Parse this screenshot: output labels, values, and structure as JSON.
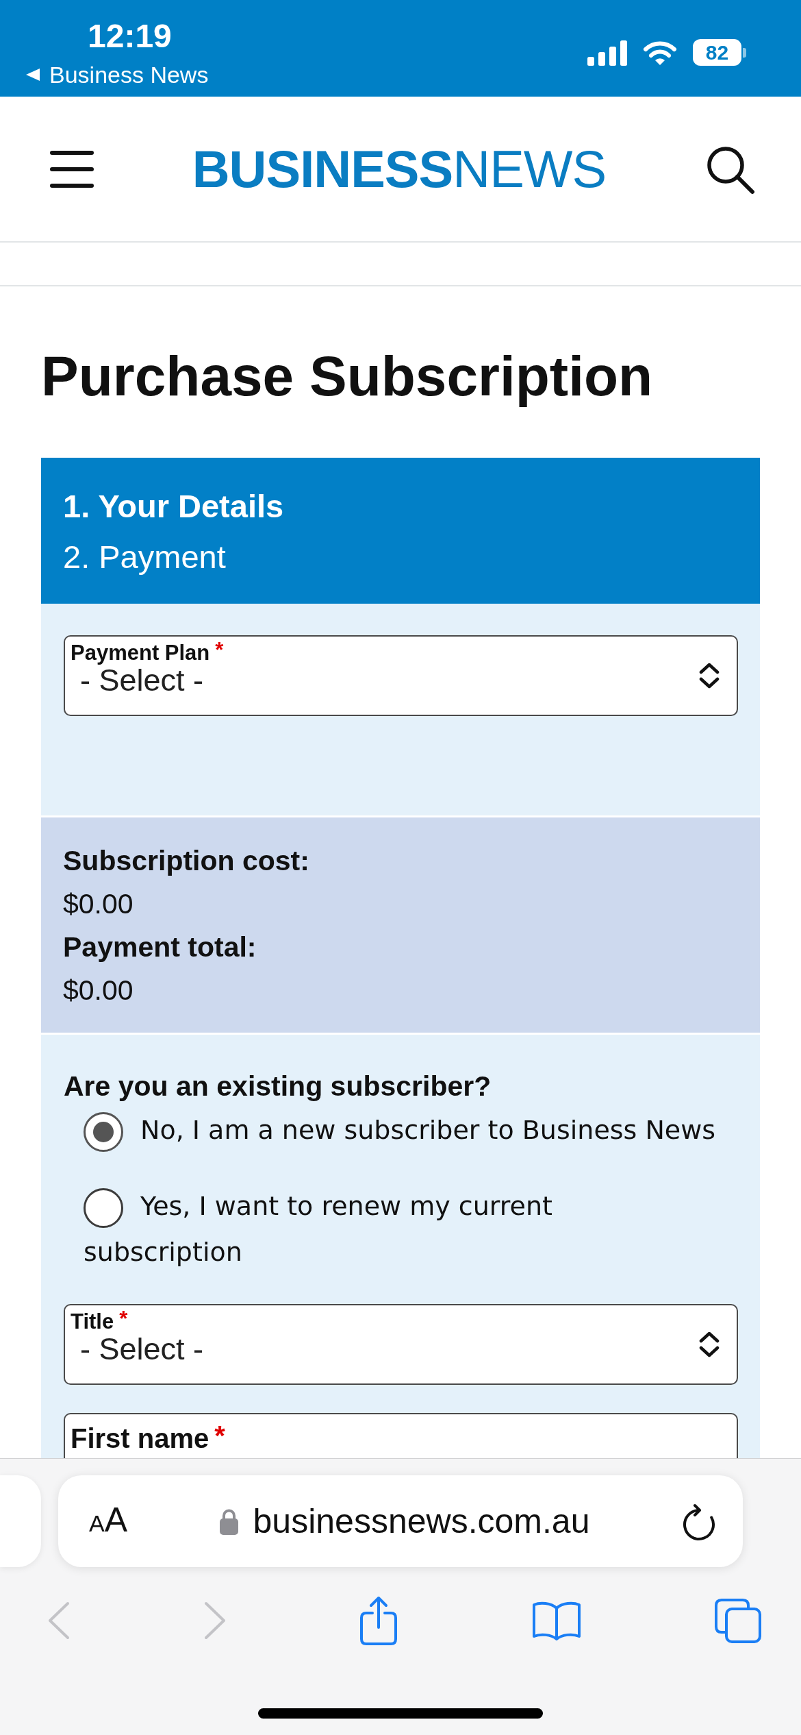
{
  "status_bar": {
    "time": "12:19",
    "back_label": "Business News",
    "battery": "82"
  },
  "header": {
    "logo": "**BUSINESS**NEWS"
  },
  "page_title": "Purchase Subscription",
  "steps": [
    {
      "label": "1. Your Details",
      "selected": true
    },
    {
      "label": "2. Payment",
      "selected": false
    }
  ],
  "plan_field": {
    "kind": "select",
    "label": "Payment Plan",
    "required_mark": "*",
    "value": "- Select -"
  },
  "summary": [
    {
      "label": "Subscription cost:",
      "value": "$0.00"
    },
    {
      "label": "Payment total:",
      "value": "$0.00"
    }
  ],
  "subscriber_question": {
    "label": "Are you an existing subscriber?",
    "options": [
      {
        "label": "No, I am a new subscriber to Business News",
        "selected": true
      },
      {
        "label": "Yes, I want to renew my current subscription",
        "selected": false
      }
    ]
  },
  "detail_fields": [
    {
      "kind": "select",
      "label": "Title",
      "required_mark": "*",
      "value": "- Select -"
    },
    {
      "kind": "text",
      "label": "First name",
      "required_mark": "*"
    }
  ],
  "browser": {
    "text_size_button": "AA",
    "url": "businessnews.com.au",
    "toolbar": [
      {
        "kind": "back",
        "disabled": true
      },
      {
        "kind": "forward",
        "disabled": true
      },
      {
        "kind": "share",
        "disabled": false
      },
      {
        "kind": "bookmarks",
        "disabled": false
      },
      {
        "kind": "tabs",
        "disabled": false
      }
    ]
  }
}
